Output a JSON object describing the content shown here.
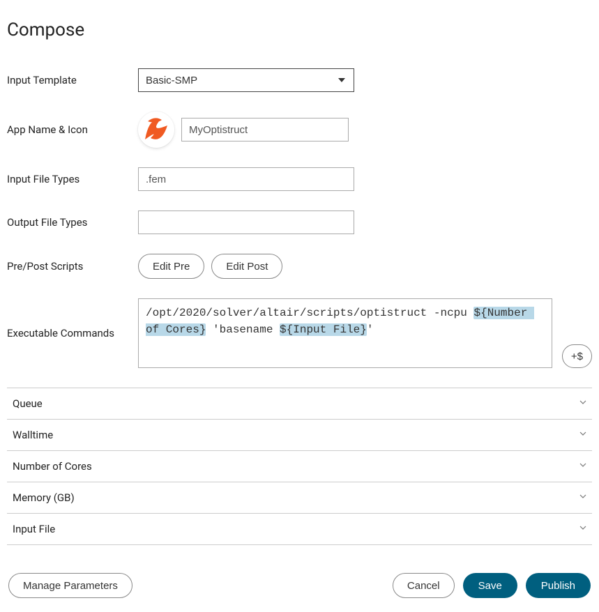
{
  "page_title": "Compose",
  "fields": {
    "input_template": {
      "label": "Input Template",
      "value": "Basic-SMP"
    },
    "app_name_icon": {
      "label": "App Name & Icon",
      "value": "MyOptistruct"
    },
    "input_file_types": {
      "label": "Input File Types",
      "value": ".fem"
    },
    "output_file_types": {
      "label": "Output File Types",
      "value": ""
    },
    "prepost": {
      "label": "Pre/Post Scripts",
      "edit_pre": "Edit Pre",
      "edit_post": "Edit Post"
    },
    "exec_commands": {
      "label": "Executable Commands",
      "segments": [
        {
          "text": "/opt/2020/solver/altair/scripts/optistruct -ncpu ",
          "highlight": false
        },
        {
          "text": "${Number of Cores}",
          "highlight": true
        },
        {
          "text": " 'basename ",
          "highlight": false
        },
        {
          "text": "${Input File}",
          "highlight": true
        },
        {
          "text": "'",
          "highlight": false
        }
      ],
      "add_placeholder": "+$"
    }
  },
  "accordion": [
    "Queue",
    "Walltime",
    "Number of Cores",
    "Memory (GB)",
    "Input File"
  ],
  "footer": {
    "manage_params": "Manage Parameters",
    "cancel": "Cancel",
    "save": "Save",
    "publish": "Publish"
  }
}
